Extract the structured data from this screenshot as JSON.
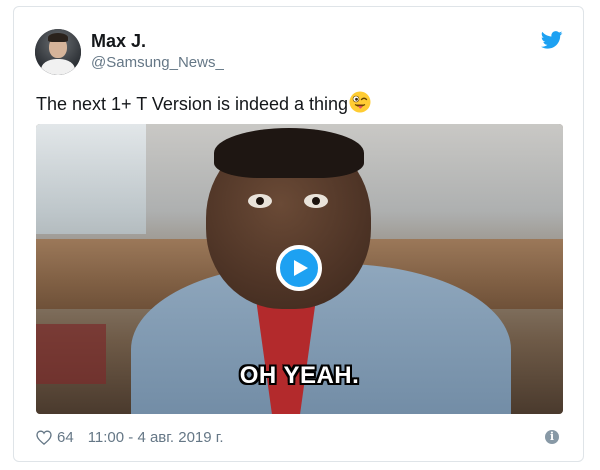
{
  "tweet": {
    "author": {
      "name": "Max J.",
      "handle": "@Samsung_News_"
    },
    "text": "The next 1+ T Version is indeed a thing",
    "emoji_name": "winking-face-with-tongue-emoji",
    "media": {
      "type": "gif",
      "caption": "OH YEAH."
    },
    "likes": "64",
    "timestamp": "11:00 - 4 авг. 2019 г."
  },
  "icons": {
    "brand": "twitter-bird-icon",
    "play": "play-icon",
    "like": "heart-outline-icon",
    "info": "info-icon"
  },
  "colors": {
    "twitter_blue": "#1da1f2",
    "text_primary": "#14171a",
    "text_secondary": "#657786",
    "border": "#dfe4e8"
  }
}
